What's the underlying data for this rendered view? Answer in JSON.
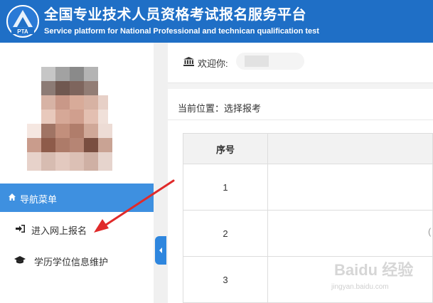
{
  "header": {
    "logo_text": "PTA",
    "title_cn": "全国专业技术人员资格考试报名服务平台",
    "title_en": "Service platform for National Professional and technican qualification test"
  },
  "sidebar": {
    "nav_header": "导航菜单",
    "nav_header_icon": "home-icon",
    "items": [
      {
        "label": "进入网上报名",
        "icon": "sign-in-icon"
      },
      {
        "label": "学历学位信息维护",
        "icon": "graduation-cap-icon"
      }
    ]
  },
  "welcome": {
    "icon": "bank-icon",
    "label": "欢迎你:"
  },
  "location": {
    "text": "当前位置：选择报考"
  },
  "table": {
    "headers": [
      "序号",
      ""
    ],
    "rows": [
      {
        "index": "1",
        "cell": ""
      },
      {
        "index": "2",
        "cell": ""
      },
      {
        "index": "3",
        "cell": ""
      }
    ]
  },
  "watermark": {
    "text": "Baidu 经验",
    "sub": "jingyan.baidu.com"
  },
  "colors": {
    "header_bg": "#1f6fc6",
    "nav_header_bg": "#3e90e0",
    "arrow": "#e02a2a"
  }
}
